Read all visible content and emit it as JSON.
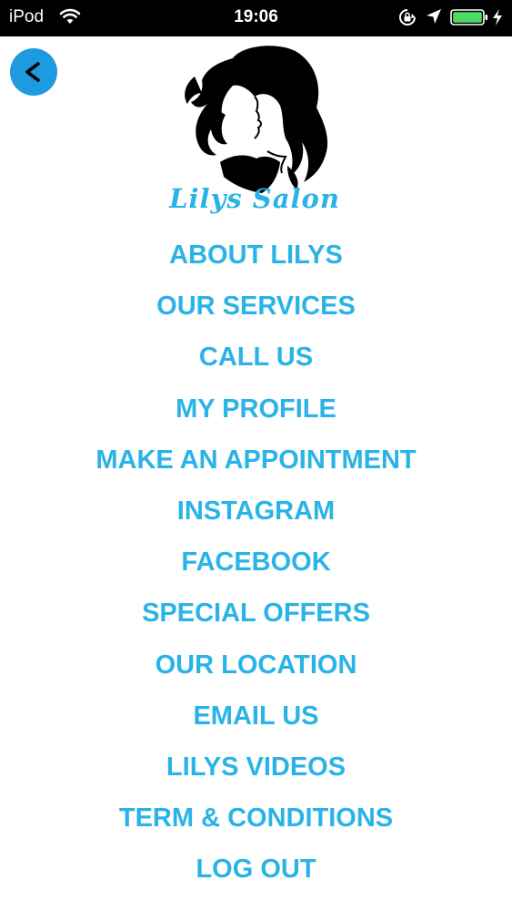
{
  "status_bar": {
    "carrier": "iPod",
    "time": "19:06",
    "icons": [
      "wifi-icon",
      "rotation-lock-icon",
      "location-arrow-icon",
      "battery-icon",
      "charging-bolt-icon"
    ]
  },
  "header": {
    "back_label": "<",
    "logo_text": "Lilys Salon"
  },
  "menu": {
    "items": [
      {
        "label": "ABOUT LILYS"
      },
      {
        "label": "OUR SERVICES"
      },
      {
        "label": "CALL US"
      },
      {
        "label": "MY PROFILE"
      },
      {
        "label": "MAKE AN APPOINTMENT"
      },
      {
        "label": "INSTAGRAM"
      },
      {
        "label": "FACEBOOK"
      },
      {
        "label": "SPECIAL OFFERS"
      },
      {
        "label": "OUR LOCATION"
      },
      {
        "label": "EMAIL US"
      },
      {
        "label": "LILYS VIDEOS"
      },
      {
        "label": "TERM & CONDITIONS"
      },
      {
        "label": "LOG OUT"
      }
    ]
  },
  "colors": {
    "accent": "#29b3e6",
    "back_button": "#1d9be0",
    "status_bar": "#000000",
    "battery": "#4cd964"
  }
}
